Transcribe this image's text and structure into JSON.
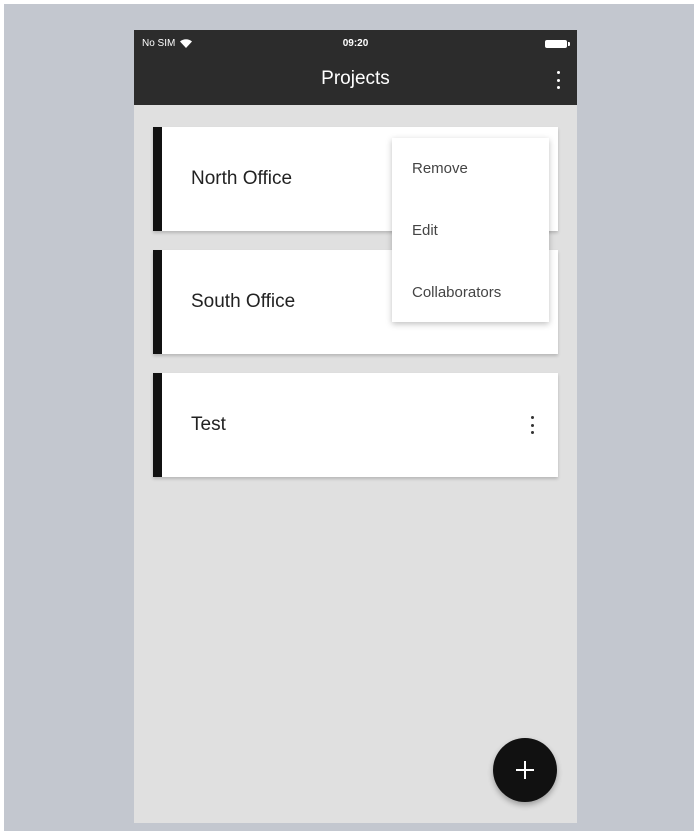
{
  "status_bar": {
    "carrier": "No SIM",
    "time": "09:20",
    "wifi_icon": "wifi-icon",
    "battery_icon": "battery-icon"
  },
  "app_bar": {
    "title": "Projects",
    "menu_icon": "more-vertical-icon",
    "background_color": "#2c2c2c"
  },
  "projects": [
    {
      "name": "North Office",
      "accent_color": "#111111"
    },
    {
      "name": "South Office",
      "accent_color": "#111111"
    },
    {
      "name": "Test",
      "accent_color": "#111111"
    }
  ],
  "context_menu": {
    "items": [
      "Remove",
      "Edit",
      "Collaborators"
    ]
  },
  "fab": {
    "icon": "plus-icon",
    "background_color": "#111111"
  },
  "colors": {
    "outer_background": "#c3c7cf",
    "list_background": "#e0e0e0"
  }
}
